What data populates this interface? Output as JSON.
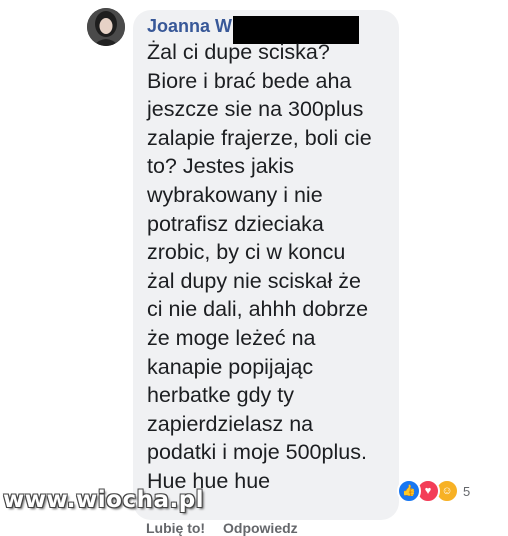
{
  "comment": {
    "author": "Joanna W",
    "text": "Żal ci dupe sciska?\nBiore i brać bede aha\njeszcze sie na 300plus\nzalapie frajerze, boli cie\nto? Jestes jakis\nwybrakowany i nie\npotrafisz dzieciaka\nzrobic, by ci w koncu\nżal dupy nie sciskał że\nci nie dali, ahhh dobrze\nże moge leżeć na\nkanapie popijając\nherbatke gdy ty\nzapierdzielasz na\npodatki i moje 500plus.\nHue hue hue"
  },
  "reactions": {
    "icons": [
      "like-icon",
      "love-icon",
      "haha-icon"
    ],
    "count": "5",
    "colors": {
      "like": "#1877f2",
      "love": "#f33e58",
      "haha": "#f7b125"
    }
  },
  "actions": {
    "like_label": "Lubię to!",
    "reply_label": "Odpowiedz"
  },
  "watermark": "www.wiocha.pl",
  "colors": {
    "bubble": "#f0f1f3",
    "author": "#385898",
    "text": "#1c1e21"
  }
}
